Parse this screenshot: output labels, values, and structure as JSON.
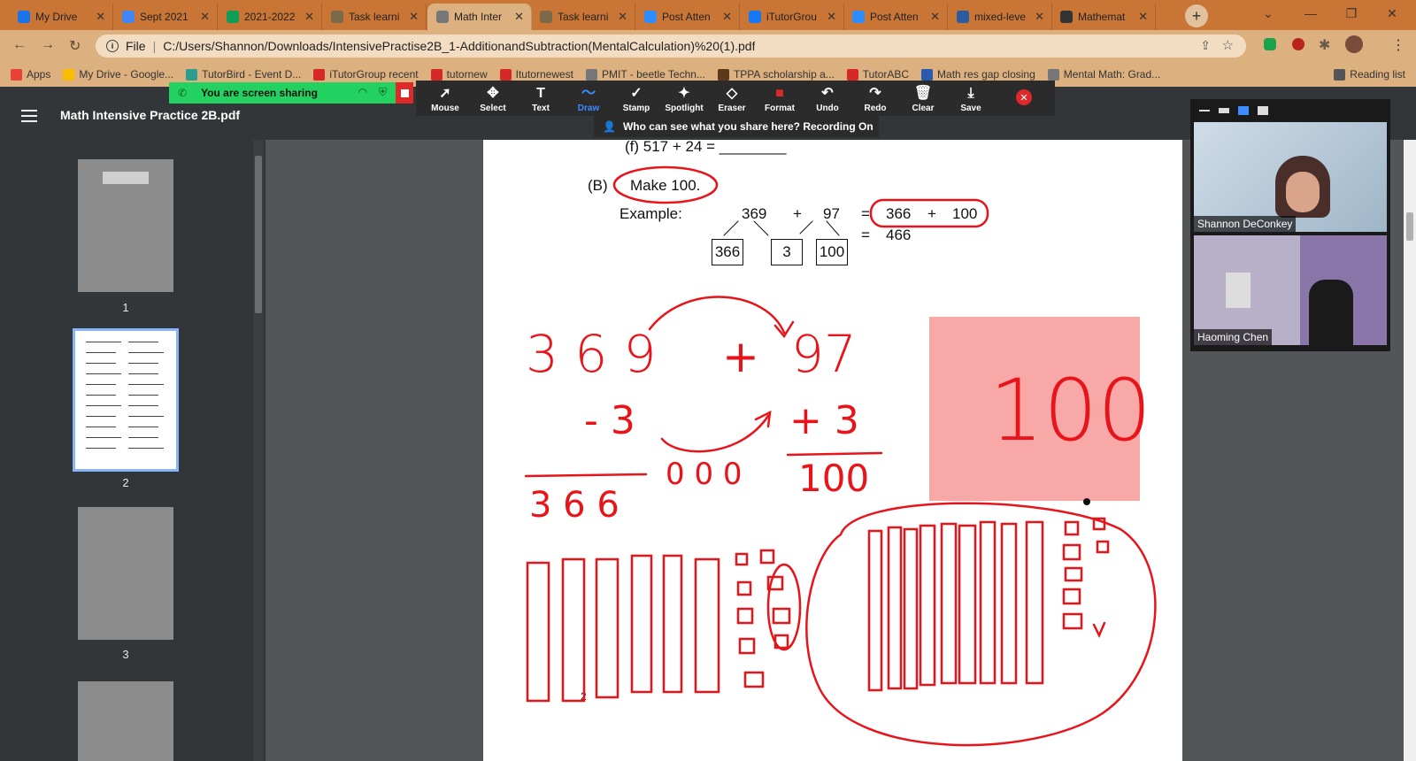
{
  "tabs": [
    {
      "title": "My Drive",
      "fav": "drive-icon",
      "color": "#1a73e8"
    },
    {
      "title": "Sept 2021",
      "fav": "docs-icon",
      "color": "#4285f4"
    },
    {
      "title": "2021-2022",
      "fav": "sheets-icon",
      "color": "#0f9d58"
    },
    {
      "title": "Task learni",
      "fav": "page-icon",
      "color": "#7a6a4a"
    },
    {
      "title": "Math Inter",
      "fav": "globe-icon",
      "color": "#777777"
    },
    {
      "title": "Task learni",
      "fav": "page-icon",
      "color": "#7a6a4a"
    },
    {
      "title": "Post Atten",
      "fav": "zoom-icon",
      "color": "#2d8cff"
    },
    {
      "title": "iTutorGrou",
      "fav": "facebook-icon",
      "color": "#1877f2"
    },
    {
      "title": "Post Atten",
      "fav": "zoom-icon",
      "color": "#2d8cff"
    },
    {
      "title": "mixed-leve",
      "fav": "mw-icon",
      "color": "#2c5aa0"
    },
    {
      "title": "Mathemat",
      "fav": "proton-icon",
      "color": "#333333"
    }
  ],
  "address": {
    "scheme": "File",
    "url": "C:/Users/Shannon/Downloads/IntensivePractise2B_1-AdditionandSubtraction(MentalCalculation)%20(1).pdf"
  },
  "bookmarks": [
    {
      "label": "Apps",
      "color": "#e94235"
    },
    {
      "label": "My Drive - Google...",
      "color": "#fbbc04"
    },
    {
      "label": "TutorBird - Event D...",
      "color": "#2a9d8f"
    },
    {
      "label": "iTutorGroup recent",
      "color": "#d62828"
    },
    {
      "label": "tutornew",
      "color": "#d62828"
    },
    {
      "label": "Itutornewest",
      "color": "#d62828"
    },
    {
      "label": "PMIT - beetle Techn...",
      "color": "#777777"
    },
    {
      "label": "TPPA scholarship a...",
      "color": "#5a3a1a"
    },
    {
      "label": "TutorABC",
      "color": "#d62828"
    },
    {
      "label": "Math res gap closing",
      "color": "#2a5ab0"
    },
    {
      "label": "Mental Math: Grad...",
      "color": "#777777"
    },
    {
      "label": "Reading list",
      "color": "#555555"
    }
  ],
  "share": {
    "status": "You are screen sharing",
    "notice": "Who can see what you share here? Recording On"
  },
  "tools": [
    {
      "label": "Mouse",
      "icon": "pointer-icon",
      "glyph": "➚"
    },
    {
      "label": "Select",
      "icon": "move-icon",
      "glyph": "✥"
    },
    {
      "label": "Text",
      "icon": "text-icon",
      "glyph": "T"
    },
    {
      "label": "Draw",
      "icon": "draw-icon",
      "glyph": "〜"
    },
    {
      "label": "Stamp",
      "icon": "stamp-icon",
      "glyph": "✓"
    },
    {
      "label": "Spotlight",
      "icon": "spotlight-icon",
      "glyph": "✦"
    },
    {
      "label": "Eraser",
      "icon": "eraser-icon",
      "glyph": "◇"
    },
    {
      "label": "Format",
      "icon": "format-icon",
      "glyph": "■"
    },
    {
      "label": "Undo",
      "icon": "undo-icon",
      "glyph": "↶"
    },
    {
      "label": "Redo",
      "icon": "redo-icon",
      "glyph": "↷"
    },
    {
      "label": "Clear",
      "icon": "trash-icon",
      "glyph": "🗑"
    },
    {
      "label": "Save",
      "icon": "save-icon",
      "glyph": "⤓"
    }
  ],
  "selected_tool": "Draw",
  "pdf": {
    "title": "Math Intensive Practice 2B.pdf",
    "thumb_pages": [
      "1",
      "2",
      "3"
    ],
    "problem_f": "(f)   517 + 24 = ________",
    "section_b": "(B)",
    "section_b_title": "Make 100.",
    "example_label": "Example:",
    "ex_a": "369",
    "ex_plus": "+",
    "ex_b": "97",
    "ex_eq": "=",
    "ex_r1": "366",
    "ex_r2": "100",
    "ex_result": "466",
    "box1": "366",
    "box2": "3",
    "box3": "100",
    "page_mark": "2"
  },
  "handwriting": {
    "top_a": "3 6 9",
    "top_plus": "+",
    "top_b": "97",
    "minus3": "- 3",
    "plus3": "+ 3",
    "zeros": "0 0 0",
    "left_result": "3 6 6",
    "right_result": "100",
    "box_number": "100",
    "ink_color": "#e8141a",
    "box_color": "#f9a8a8"
  },
  "participants": [
    {
      "name": "Shannon DeConkey"
    },
    {
      "name": "Haoming Chen"
    }
  ],
  "colors": {
    "tabstrip": "#c97535",
    "toolbar": "#dcb07f",
    "share_green": "#23d160",
    "stop_red": "#e02828",
    "viewer_bg": "#323639"
  }
}
